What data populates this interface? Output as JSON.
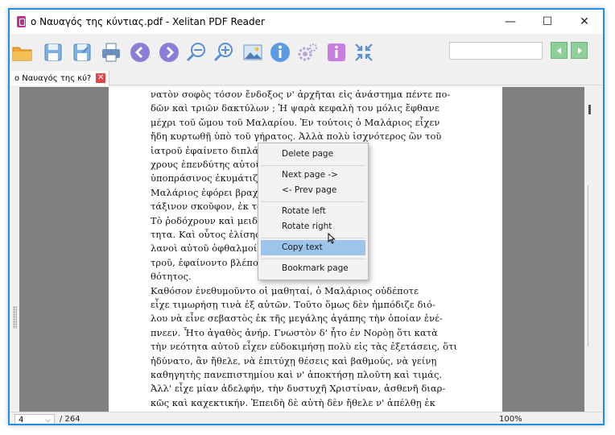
{
  "window": {
    "title": "ο Ναυαγός της κύντιας.pdf - Xelitan PDF Reader",
    "controls": {
      "minimize": "—",
      "maximize": "☐",
      "close": "✕"
    }
  },
  "toolbar": {
    "buttons": [
      "open-folder",
      "save",
      "save-as",
      "print",
      "previous-page",
      "next-page",
      "zoom-out",
      "zoom-in",
      "image",
      "info",
      "settings",
      "text-info",
      "fit-page"
    ],
    "search": {
      "value": "",
      "placeholder": ""
    },
    "search_prev_icon": "◀",
    "search_next_icon": "▶"
  },
  "tabs": [
    {
      "label": "ο Ναυαγός της κύ?",
      "close": "✕"
    }
  ],
  "document": {
    "lines": [
      "νατὸν σοφὸς τόσον ἔνδοξος ν' ἀρχῆται εἰς ἀνάστημα πέντε πο-",
      "δῶν καὶ τριῶν δακτύλων ; Ἡ ψαρὰ κεφαλὴ του μόλις ἔφθανε",
      "μέχρι τοῦ ὤμου τοῦ Μαλαρίου. Ἐν τούτοις ὁ Μαλάριος εἶχεν",
      "ἤδη κυρτωθῇ ὑπὸ τοῦ γήρατος. Ἀλλὰ πολὺ ἰσχνότερος ὢν τοῦ",
      "ἰατροῦ ἐφαίνετο διπλάσιος                εὐρὺς καστανό-",
      "χρους ἐπενδύτης αὐτοῦ                 ς καταντήσας",
      "ὑποπράσινος ἐκυμάτιζεν                ὶ κοντοῦ. Ὁ",
      "Μαλάριος ἐφόρει βραχεῖ               αὶ μέλανα με-",
      "τάξινον σκοῦφον, ἐκ τοῦ             αί τινες τρίχες.",
      "Τὸ ῥοδόχρουν καὶ μειδι              ν ἄκραν πραό-",
      "τητα. Καὶ οὗτος ἐλίσης              ν ὁποίων οἱ γα-",
      "λανοὶ αὐτοῦ ὀφθαλμοί,               βλέμμα τοῦ ἰα-",
      "τροῦ, ἐφαίνοντο βλέπον              αντλήτου ἀγα-",
      "θότητος.",
      "    Καθόσον ἐνεθυμοῦντο οἱ μαθηταί, ὁ Μαλάριος οὐδέποτε",
      "εἶχε τιμωρήσῃ τινὰ ἐξ αὐτῶν. Τοῦτο ὅμως δὲν ἠμπόδιζε διό-",
      "λου νὰ εἶνε σεβαστὸς ἐκ τῆς μεγάλης ἀγάπης τὴν ὁποίαν ἐνέ-",
      "πνεεν. Ἦτο ἀγαθὸς ἀνήρ. Γνωστὸν δ' ἦτο ἐν Νορὸῃ ὅτι κατὰ",
      "τὴν νεότητα αὐτοῦ εἶχεν εὐδοκιμήσῃ πολὺ εἰς τὰς ἐξετάσεις, ὅτι",
      "ἠδύνατο, ἂν ἤθελε, νὰ ἐπιτύχῃ θέσεις καὶ βαθμούς, νὰ γείνῃ",
      "καθηγητὴς πανεπιστημίου καὶ ν' ἀποκτήσῃ πλοῦτη καὶ τιμάς.",
      "Ἀλλ' εἶχε μίαν ἀδελφήν, τὴν δυστυχῆ Χριστίναν, ἀσθενῆ διαρ-",
      "κῶς καὶ καχεκτικήν. Ἐπειδὴ δὲ αὐτὴ δὲν ἤθελε ν' ἀπέλθῃ ἐκ"
    ]
  },
  "context_menu": {
    "items": [
      {
        "label": "Delete page",
        "group": 0
      },
      {
        "label": "Next page ->",
        "group": 1
      },
      {
        "label": "<- Prev page",
        "group": 1
      },
      {
        "label": "Rotate left",
        "group": 2
      },
      {
        "label": "Rotate right",
        "group": 2
      },
      {
        "label": "Copy text",
        "group": 3,
        "highlighted": true
      },
      {
        "label": "Bookmark page",
        "group": 4
      }
    ]
  },
  "status": {
    "current_page": "4",
    "total_pages": "/ 264",
    "zoom": "100%"
  },
  "colors": {
    "accent_border": "#1f8fe6",
    "menu_highlight": "#9ec4ea",
    "tab_close": "#e04848",
    "app_icon": "#c0308d"
  }
}
